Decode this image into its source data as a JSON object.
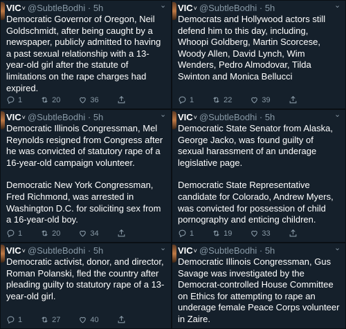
{
  "tweets": [
    {
      "name": "VIC",
      "handle": "@SubtleBodhi",
      "time": "5h",
      "paragraphs": [
        "Democratic Governor of Oregon, Neil Goldschmidt, after being caught by a newspaper, publicly admitted to having a past sexual relationship with a 13-year-old girl after the statute of limitations on the rape charges had expired."
      ],
      "replies": "1",
      "retweets": "20",
      "likes": "36"
    },
    {
      "name": "VIC",
      "handle": "@SubtleBodhi",
      "time": "5h",
      "paragraphs": [
        "Democrats and Hollywood actors still defend him to this day, including, Whoopi Goldberg, Martin Scorcese, Woody Allen, David Lynch, Wim Wenders, Pedro Almodovar, Tilda Swinton and Monica Bellucci"
      ],
      "replies": "1",
      "retweets": "22",
      "likes": "39"
    },
    {
      "name": "VIC",
      "handle": "@SubtleBodhi",
      "time": "5h",
      "paragraphs": [
        "Democratic Illinois Congressman, Mel Reynolds resigned from Congress after he was convicted of statutory rape of a 16-year-old campaign volunteer.",
        "Democratic New York Congressman, Fred Richmond, was arrested in Washington D.C. for soliciting sex from a 16-year-old boy."
      ],
      "replies": "1",
      "retweets": "20",
      "likes": "34"
    },
    {
      "name": "VIC",
      "handle": "@SubtleBodhi",
      "time": "5h",
      "paragraphs": [
        "Democratic State Senator from Alaska, George Jacko, was found guilty of sexual harassment of an underage legislative page.",
        "Democratic State Representative candidate for Colorado, Andrew Myers, was convicted for possession of child pornography and enticing children."
      ],
      "replies": "1",
      "retweets": "19",
      "likes": "33"
    },
    {
      "name": "VIC",
      "handle": "@SubtleBodhi",
      "time": "5h",
      "paragraphs": [
        "Democratic activist, donor, and director, Roman Polanski, fled the country after pleading guilty to statutory rape of a 13-year-old girl."
      ],
      "replies": "1",
      "retweets": "27",
      "likes": "40"
    },
    {
      "name": "VIC",
      "handle": "@SubtleBodhi",
      "time": "5h",
      "paragraphs": [
        "Democratic Illinois Congressman, Gus Savage was investigated by the Democrat-controlled House Committee on Ethics for attempting to rape an underage female Peace Corps volunteer in Zaire."
      ],
      "replies": "",
      "retweets": "",
      "likes": ""
    }
  ],
  "icons": {
    "reply": "reply-icon",
    "retweet": "retweet-icon",
    "like": "heart-icon",
    "share": "share-icon",
    "verified": "verified-icon",
    "menu": "chevron-down-icon"
  },
  "colors": {
    "background": "#15202b",
    "text": "#ffffff",
    "muted": "#8899a6"
  }
}
